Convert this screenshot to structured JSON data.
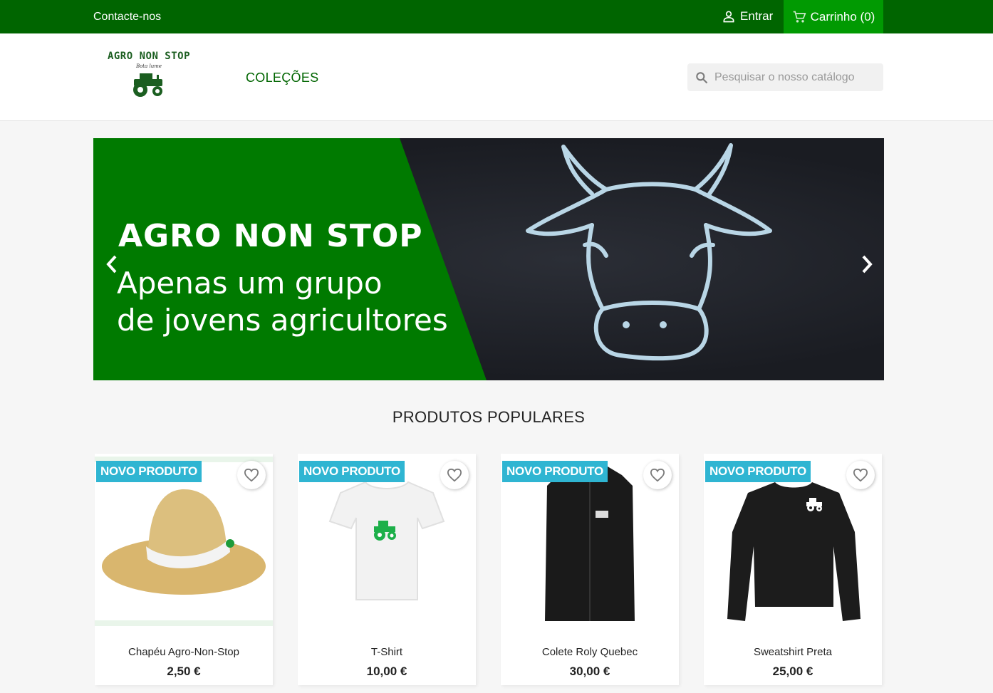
{
  "topbar": {
    "contact": "Contacte-nos",
    "login": "Entrar",
    "cart": "Carrinho (0)"
  },
  "header": {
    "logo_title": "AGRO NON STOP",
    "logo_sub": "Bota lume",
    "menu_item": "COLEÇÕES",
    "search_placeholder": "Pesquisar o nosso catálogo"
  },
  "slider": {
    "title": "AGRO NON STOP",
    "subtitle_line1": "Apenas um grupo",
    "subtitle_line2": "de jovens agricultores"
  },
  "section_title": "PRODUTOS POPULARES",
  "products": [
    {
      "badge": "NOVO PRODUTO",
      "name": "Chapéu Agro-Non-Stop",
      "price": "2,50 €"
    },
    {
      "badge": "NOVO PRODUTO",
      "name": "T-Shirt",
      "price": "10,00 €"
    },
    {
      "badge": "NOVO PRODUTO",
      "name": "Colete Roly Quebec",
      "price": "30,00 €"
    },
    {
      "badge": "NOVO PRODUTO",
      "name": "Sweatshirt Preta",
      "price": "25,00 €"
    }
  ],
  "colors": {
    "topbar": "#006500",
    "cart": "#019a02",
    "slide_green": "#007a00",
    "badge": "#2fb5d2"
  },
  "icons": [
    "user-icon",
    "cart-icon",
    "search-icon",
    "chevron-left-icon",
    "chevron-right-icon",
    "heart-icon",
    "tractor-icon"
  ]
}
